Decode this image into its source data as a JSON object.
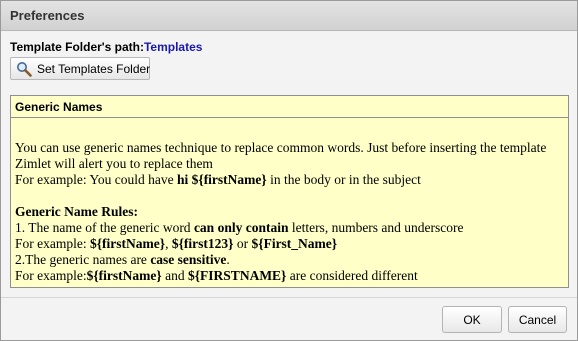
{
  "dialog": {
    "title": "Preferences"
  },
  "template_folder": {
    "label": "Template Folder's path:",
    "value": "Templates",
    "button_label": "Set Templates Folder",
    "button_icon": "magnifier-icon"
  },
  "generic_names": {
    "header": "Generic Names",
    "intro_line1": "You can use generic names technique to replace common words. Just before inserting the template",
    "intro_line2": "Zimlet will alert you to replace them",
    "example_prefix": "For example: You could have ",
    "example_bold": "hi ${firstName}",
    "example_suffix": " in the body or in the subject",
    "rules_title": "Generic Name Rules:",
    "rule1_a": "1. The name of the generic word ",
    "rule1_bold": "can only contain",
    "rule1_b": " letters, numbers and underscore",
    "rule1_example_prefix": "For example: ",
    "rule1_example_1": "${firstName}",
    "rule1_example_sep1": ", ",
    "rule1_example_2": "${first123}",
    "rule1_example_sep2": " or ",
    "rule1_example_3": "${First_Name}",
    "rule2_a": "2.The generic names are ",
    "rule2_bold": "case sensitive",
    "rule2_b": ".",
    "rule2_example_prefix": "For example:",
    "rule2_example_1": "${firstName}",
    "rule2_example_mid": " and ",
    "rule2_example_2": "${FIRSTNAME}",
    "rule2_example_suffix": " are considered different"
  },
  "buttons": {
    "ok": "OK",
    "cancel": "Cancel"
  },
  "colors": {
    "content_background": "#ffffc8",
    "path_value": "#1a1aa8"
  }
}
